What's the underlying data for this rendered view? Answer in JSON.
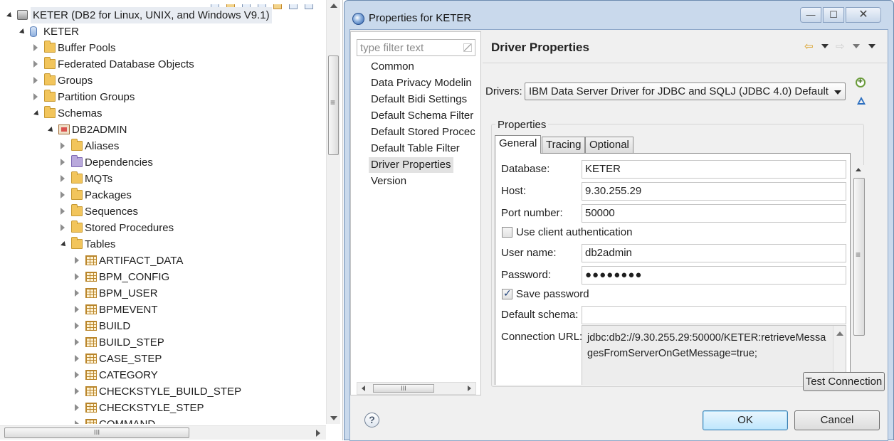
{
  "tree": {
    "items": [
      {
        "label": "KETER (DB2 for Linux, UNIX, and Windows V9.1)",
        "icon": "server-icon",
        "expanded": true
      },
      {
        "label": "KETER",
        "icon": "database-icon",
        "expanded": true
      },
      {
        "label": "Buffer Pools",
        "icon": "folder-icon",
        "expanded": false
      },
      {
        "label": "Federated Database Objects",
        "icon": "folder-icon",
        "expanded": false
      },
      {
        "label": "Groups",
        "icon": "folder-icon",
        "expanded": false
      },
      {
        "label": "Partition Groups",
        "icon": "folder-icon",
        "expanded": false
      },
      {
        "label": "Schemas",
        "icon": "folder-icon",
        "expanded": true
      },
      {
        "label": "DB2ADMIN",
        "icon": "schema-icon",
        "expanded": true
      },
      {
        "label": "Aliases",
        "icon": "folder-icon",
        "expanded": false
      },
      {
        "label": "Dependencies",
        "icon": "folder-icon",
        "expanded": false
      },
      {
        "label": "MQTs",
        "icon": "folder-icon",
        "expanded": false
      },
      {
        "label": "Packages",
        "icon": "folder-icon",
        "expanded": false
      },
      {
        "label": "Sequences",
        "icon": "folder-icon",
        "expanded": false
      },
      {
        "label": "Stored Procedures",
        "icon": "folder-icon",
        "expanded": false
      },
      {
        "label": "Tables",
        "icon": "folder-icon",
        "expanded": true
      },
      {
        "label": "ARTIFACT_DATA",
        "icon": "table-icon",
        "expanded": false
      },
      {
        "label": "BPM_CONFIG",
        "icon": "table-icon",
        "expanded": false
      },
      {
        "label": "BPM_USER",
        "icon": "table-icon",
        "expanded": false
      },
      {
        "label": "BPMEVENT",
        "icon": "table-icon",
        "expanded": false
      },
      {
        "label": "BUILD",
        "icon": "table-icon",
        "expanded": false
      },
      {
        "label": "BUILD_STEP",
        "icon": "table-icon",
        "expanded": false
      },
      {
        "label": "CASE_STEP",
        "icon": "table-icon",
        "expanded": false
      },
      {
        "label": "CATEGORY",
        "icon": "table-icon",
        "expanded": false
      },
      {
        "label": "CHECKSTYLE_BUILD_STEP",
        "icon": "table-icon",
        "expanded": false
      },
      {
        "label": "CHECKSTYLE_STEP",
        "icon": "table-icon",
        "expanded": false
      },
      {
        "label": "COMMAND",
        "icon": "table-icon",
        "expanded": false
      }
    ]
  },
  "dialog": {
    "title": "Properties for KETER",
    "window_buttons": {
      "minimize": "—",
      "maximize": "☐",
      "close": "✕"
    },
    "filter_placeholder": "type filter text",
    "nav_items": [
      "Common",
      "Data Privacy Modelin",
      "Default Bidi Settings",
      "Default Schema Filter",
      "Default Stored Procec",
      "Default Table Filter",
      "Driver Properties",
      "Version"
    ],
    "selected_nav": "Driver Properties",
    "nav_scroll_grip": "III",
    "page_title": "Driver Properties",
    "drivers_label": "Drivers:",
    "driver_selected": "IBM Data Server Driver for JDBC and SQLJ (JDBC 4.0) Default",
    "properties_group": "Properties",
    "tabs": [
      "General",
      "Tracing",
      "Optional"
    ],
    "active_tab": "General",
    "fields": {
      "database_label": "Database:",
      "database_value": "KETER",
      "host_label": "Host:",
      "host_value": "9.30.255.29",
      "port_label": "Port number:",
      "port_value": "50000",
      "client_auth_label": "Use client authentication",
      "client_auth_checked": false,
      "username_label": "User name:",
      "username_value": "db2admin",
      "password_label": "Password:",
      "password_value": "●●●●●●●●",
      "save_password_label": "Save password",
      "save_password_checked": true,
      "default_schema_label": "Default schema:",
      "default_schema_value": "",
      "connection_url_label": "Connection URL:",
      "connection_url_value": "jdbc:db2://9.30.255.29:50000/KETER:retrieveMessagesFromServerOnGetMessage=true;"
    },
    "test_connection": "Test Connection",
    "help": "?",
    "ok": "OK",
    "cancel": "Cancel"
  },
  "scroll": {
    "grip": "III"
  }
}
